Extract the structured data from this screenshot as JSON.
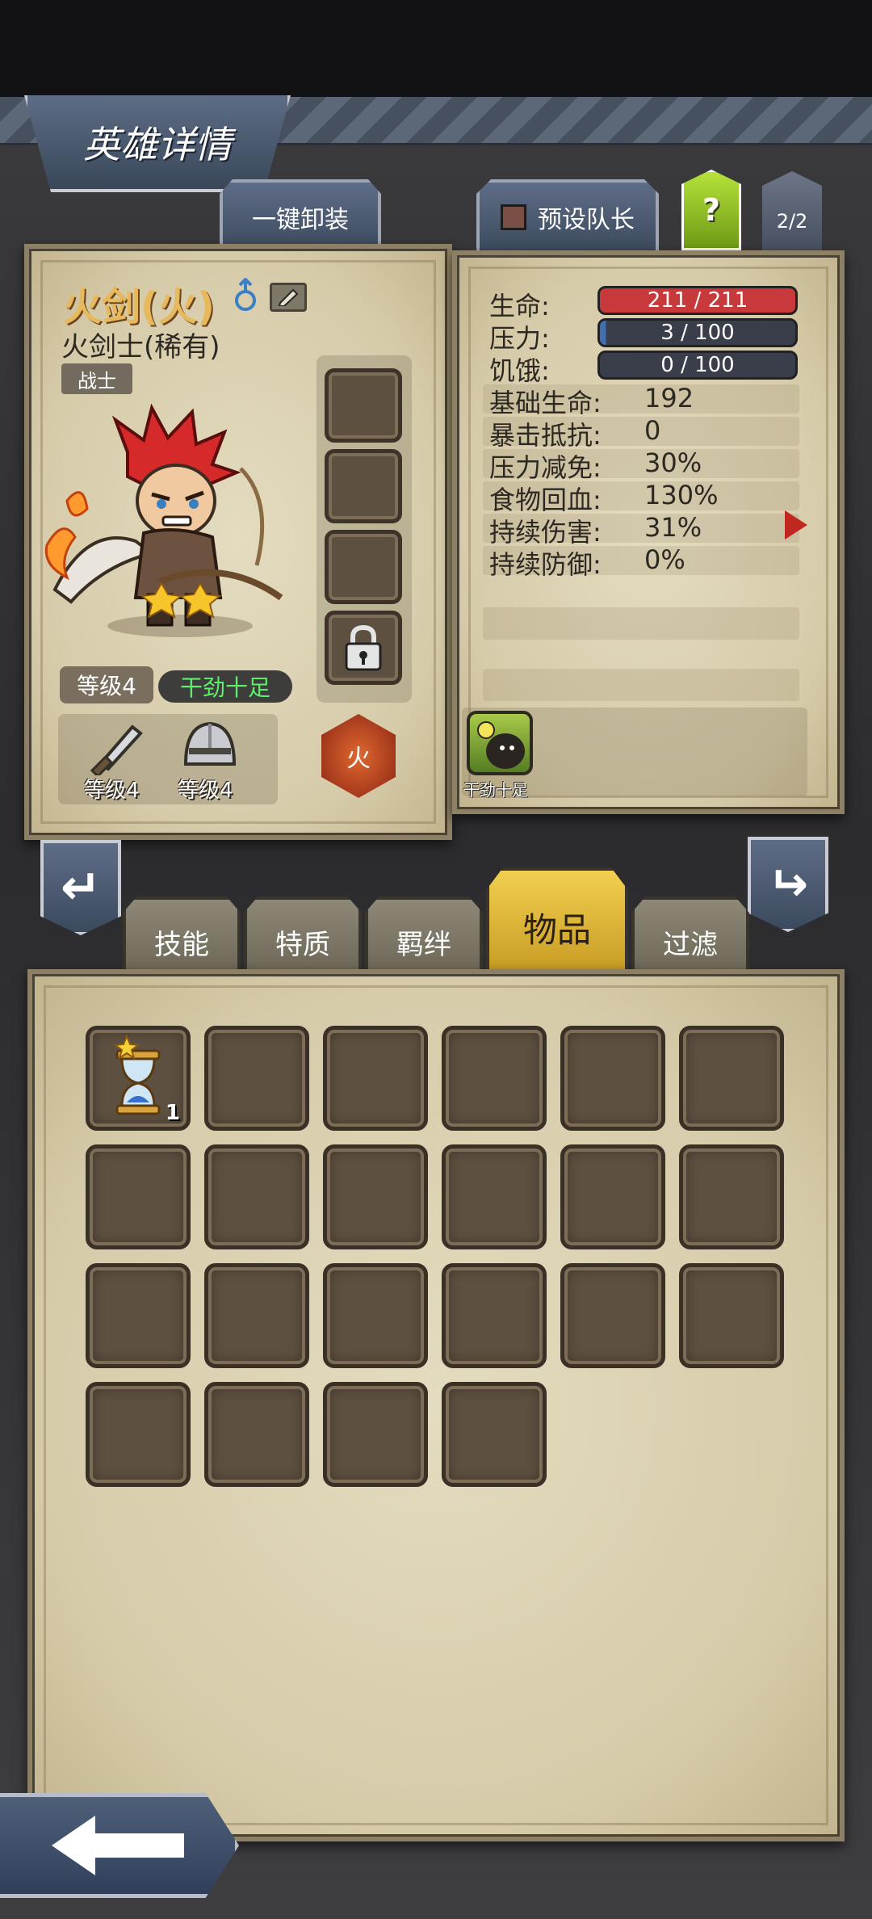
{
  "screen_title": "英雄详情",
  "top_buttons": {
    "unequip_all": "一键卸装",
    "preset_captain": "预设队长",
    "help": "?",
    "page": "2/2"
  },
  "hero": {
    "name": "火剑(火)",
    "subtitle": "火剑士(稀有)",
    "class": "战士",
    "stars": 2,
    "level": "等级4",
    "mood": "干劲十足",
    "element": "火",
    "equipment": [
      {
        "icon": "sword-icon",
        "level": "等级4"
      },
      {
        "icon": "helmet-icon",
        "level": "等级4"
      }
    ]
  },
  "stats": {
    "bars": [
      {
        "label": "生命:",
        "value": "211 / 211",
        "fill": 1.0,
        "color": "#c8393b"
      },
      {
        "label": "压力:",
        "value": "3 / 100",
        "fill": 0.03,
        "color": "#3a3d4a"
      },
      {
        "label": "饥饿:",
        "value": "0 / 100",
        "fill": 0.0,
        "color": "#3a3d4a"
      }
    ],
    "rows": [
      {
        "label": "基础生命:",
        "value": "192"
      },
      {
        "label": "暴击抵抗:",
        "value": "0"
      },
      {
        "label": "压力减免:",
        "value": "30%"
      },
      {
        "label": "食物回血:",
        "value": "130%"
      },
      {
        "label": "持续伤害:",
        "value": "31%"
      },
      {
        "label": "持续防御:",
        "value": "0%"
      }
    ],
    "trait_label": "干劲十足"
  },
  "category_tabs": [
    {
      "label": "技能",
      "active": false
    },
    {
      "label": "特质",
      "active": false
    },
    {
      "label": "羁绊",
      "active": false
    },
    {
      "label": "物品",
      "active": true
    },
    {
      "label": "过滤",
      "active": false
    }
  ],
  "inventory": {
    "slots": 22,
    "items": [
      {
        "slot": 0,
        "icon": "hourglass-icon",
        "count": "1"
      }
    ]
  },
  "colors": {
    "accent_gold": "#e8b85c",
    "mood_green": "#5ef06a",
    "health_red": "#c8393b",
    "tab_active": "#f2cf50"
  }
}
